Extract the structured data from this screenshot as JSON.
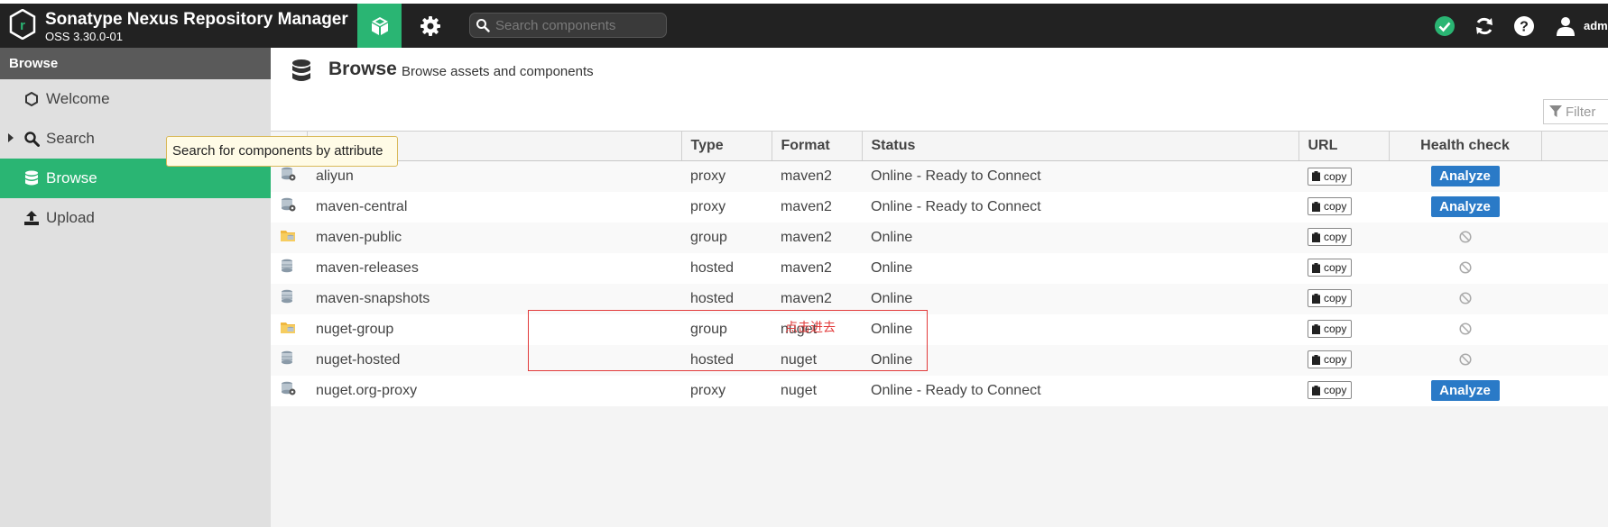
{
  "header": {
    "title": "Sonatype Nexus Repository Manager",
    "version": "OSS 3.30.0-01",
    "search_placeholder": "Search components",
    "user": "adm"
  },
  "sidebar": {
    "heading": "Browse",
    "items": [
      {
        "label": "Welcome",
        "icon": "hexagon-icon"
      },
      {
        "label": "Search",
        "icon": "search-icon"
      },
      {
        "label": "Browse",
        "icon": "database-icon",
        "active": true
      },
      {
        "label": "Upload",
        "icon": "upload-icon"
      }
    ]
  },
  "tooltip": "Search for components by attribute",
  "page": {
    "title": "Browse",
    "subtitle": "Browse assets and components",
    "filter_placeholder": "Filter"
  },
  "table": {
    "columns": [
      "Type",
      "Format",
      "Status",
      "URL",
      "Health check"
    ],
    "copy_label": "copy",
    "analyze_label": "Analyze",
    "rows": [
      {
        "name": "aliyun",
        "type": "proxy",
        "format": "maven2",
        "status": "Online - Ready to Connect",
        "health": "analyze"
      },
      {
        "name": "maven-central",
        "type": "proxy",
        "format": "maven2",
        "status": "Online - Ready to Connect",
        "health": "analyze"
      },
      {
        "name": "maven-public",
        "type": "group",
        "format": "maven2",
        "status": "Online",
        "health": "none"
      },
      {
        "name": "maven-releases",
        "type": "hosted",
        "format": "maven2",
        "status": "Online",
        "health": "none"
      },
      {
        "name": "maven-snapshots",
        "type": "hosted",
        "format": "maven2",
        "status": "Online",
        "health": "none"
      },
      {
        "name": "nuget-group",
        "type": "group",
        "format": "nuget",
        "status": "Online",
        "health": "none"
      },
      {
        "name": "nuget-hosted",
        "type": "hosted",
        "format": "nuget",
        "status": "Online",
        "health": "none"
      },
      {
        "name": "nuget.org-proxy",
        "type": "proxy",
        "format": "nuget",
        "status": "Online - Ready to Connect",
        "health": "analyze"
      }
    ]
  },
  "annotation": "点击进去",
  "colors": {
    "topbar": "#222222",
    "accent_green": "#2ab573",
    "analyze_blue": "#2a7ac7",
    "annotation_red": "#e23b3b"
  }
}
